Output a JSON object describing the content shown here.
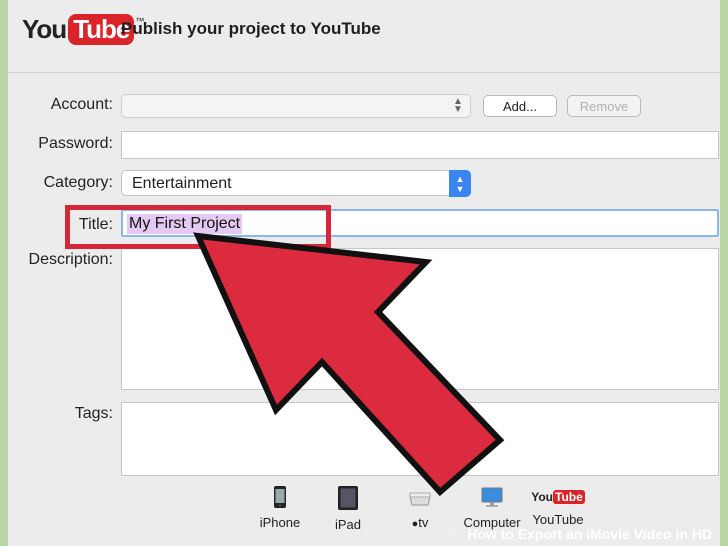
{
  "header": {
    "logo_you": "You",
    "logo_tube": "Tube",
    "logo_tm": "™",
    "title": "Publish your project to YouTube"
  },
  "form": {
    "account_label": "Account:",
    "account_value": "",
    "add_button": "Add...",
    "remove_button": "Remove",
    "password_label": "Password:",
    "password_value": "",
    "category_label": "Category:",
    "category_value": "Entertainment",
    "title_label": "Title:",
    "title_value": "My First Project",
    "description_label": "Description:",
    "description_value": "",
    "tags_label": "Tags:",
    "tags_value": ""
  },
  "devices": [
    {
      "label": "iPhone",
      "icon": "iphone-icon"
    },
    {
      "label": "iPad",
      "icon": "ipad-icon"
    },
    {
      "label": "tv",
      "icon": "apple-tv-icon"
    },
    {
      "label": "Computer",
      "icon": "computer-icon"
    },
    {
      "label": "YouTube",
      "icon": "youtube-icon"
    }
  ],
  "watermark": {
    "wiki": "wiki",
    "text": "How to Export an iMovie Video in HD"
  },
  "colors": {
    "callout": "#d6263a",
    "accent_blue": "#3a86f0",
    "selection": "#e4c9f3",
    "youtube_red": "#d9252a"
  }
}
